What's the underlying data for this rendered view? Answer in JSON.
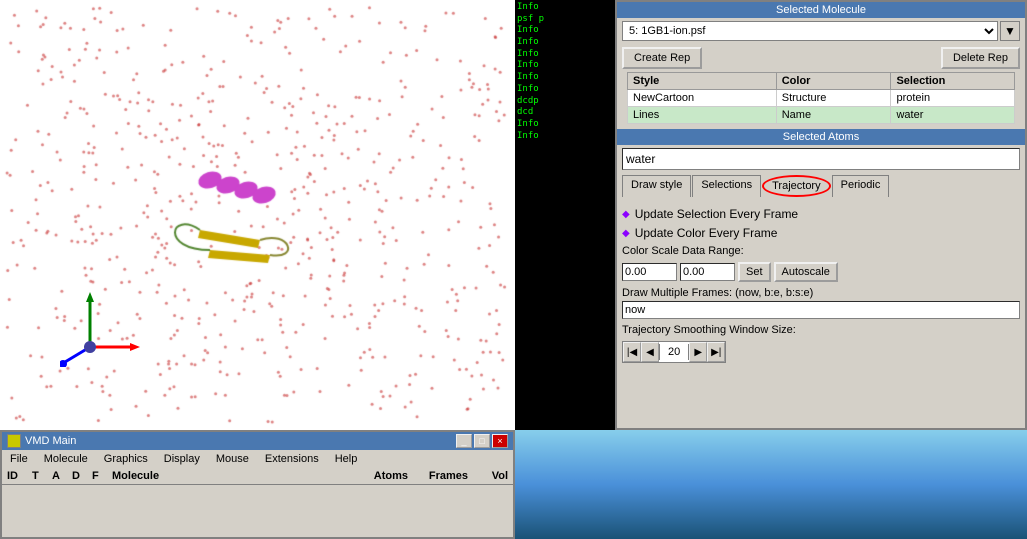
{
  "viewport": {
    "background": "white"
  },
  "log_panel": {
    "lines": [
      "Info",
      "psf p",
      "Info",
      "Info",
      "Info",
      "Info",
      "Info",
      "Info",
      "dcdp",
      "dcd",
      "Info",
      "Info"
    ]
  },
  "right_panel": {
    "selected_molecule_label": "Selected Molecule",
    "molecule_value": "5: 1GB1-ion.psf",
    "create_rep_label": "Create Rep",
    "delete_rep_label": "Delete Rep",
    "table_headers": [
      "Style",
      "Color",
      "Selection"
    ],
    "table_rows": [
      {
        "style": "NewCartoon",
        "color": "Structure",
        "selection": "protein"
      },
      {
        "style": "Lines",
        "color": "Name",
        "selection": "water"
      }
    ],
    "selected_atoms_label": "Selected Atoms",
    "atom_input_value": "water",
    "tabs": [
      "Draw style",
      "Selections",
      "Trajectory",
      "Periodic"
    ],
    "active_tab": "Trajectory",
    "update_selection_label": "Update Selection Every Frame",
    "update_color_label": "Update Color Every Frame",
    "color_scale_label": "Color Scale Data Range:",
    "color_scale_min": "0.00",
    "color_scale_max": "0.00",
    "set_label": "Set",
    "autoscale_label": "Autoscale",
    "draw_frames_label": "Draw Multiple Frames: (now, b:e, b:s:e)",
    "draw_frames_value": "now",
    "smoothing_label": "Trajectory Smoothing Window Size:",
    "smoothing_value": "20"
  },
  "vmd_main": {
    "title": "VMD Main",
    "menu_items": [
      "File",
      "Molecule",
      "Graphics",
      "Display",
      "Mouse",
      "Extensions",
      "Help"
    ],
    "table_headers": [
      "ID",
      "T",
      "A",
      "D",
      "F",
      "Molecule",
      "Atoms",
      "Frames",
      "Vol"
    ],
    "graphics_label": "Graphics"
  }
}
